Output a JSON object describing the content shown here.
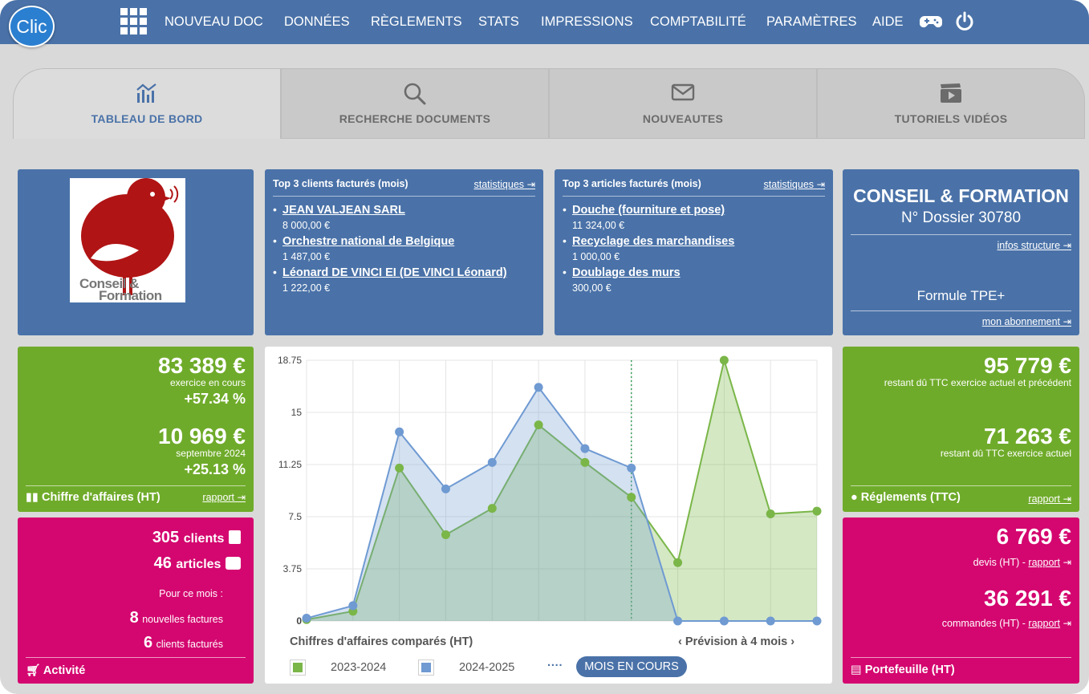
{
  "app": {
    "logo_text": "Clic"
  },
  "nav": {
    "items": [
      "NOUVEAU DOC",
      "DONNÉES",
      "RÈGLEMENTS",
      "STATS",
      "IMPRESSIONS",
      "COMPTABILITÉ",
      "PARAMÈTRES",
      "AIDE"
    ],
    "icons": [
      "apps-grid-icon",
      "gamepad-icon",
      "power-icon"
    ]
  },
  "tabs": [
    {
      "label": "TABLEAU DE BORD",
      "icon": "chart-icon",
      "active": true
    },
    {
      "label": "RECHERCHE DOCUMENTS",
      "icon": "search-icon",
      "active": false
    },
    {
      "label": "NOUVEAUTES",
      "icon": "envelope-icon",
      "active": false
    },
    {
      "label": "TUTORIELS VIDÉOS",
      "icon": "video-icon",
      "active": false
    }
  ],
  "company_logo": {
    "line1": "Conseil &",
    "line2": "Formation"
  },
  "top_clients": {
    "title": "Top 3 clients facturés (mois)",
    "link": "statistiques",
    "items": [
      {
        "name": "JEAN VALJEAN SARL",
        "value": "8 000,00 €"
      },
      {
        "name": "Orchestre national de Belgique",
        "value": "1 487,00 €"
      },
      {
        "name": "Léonard DE VINCI EI (DE VINCI Léonard)",
        "value": "1 222,00 €"
      }
    ]
  },
  "top_articles": {
    "title": "Top 3 articles facturés (mois)",
    "link": "statistiques",
    "items": [
      {
        "name": "Douche (fourniture et pose)",
        "value": "11 324,00 €"
      },
      {
        "name": "Recyclage des marchandises",
        "value": "1 000,00 €"
      },
      {
        "name": "Doublage des murs",
        "value": "300,00 €"
      }
    ]
  },
  "company": {
    "name": "CONSEIL & FORMATION",
    "dossier": "N° Dossier 30780",
    "infos_link": "infos structure",
    "formule": "Formule TPE+",
    "abonnement_link": "mon abonnement"
  },
  "ca": {
    "amount1": "83 389 €",
    "label1": "exercice en cours",
    "pct1": "+57.34 %",
    "amount2": "10 969 €",
    "label2": "septembre 2024",
    "pct2": "+25.13 %",
    "footer": "Chiffre d'affaires (HT)",
    "link": "rapport"
  },
  "activite": {
    "clients_count": "305",
    "clients_label": "clients",
    "articles_count": "46",
    "articles_label": "articles",
    "month_label": "Pour ce mois :",
    "factures_count": "8",
    "factures_label": "nouvelles factures",
    "factures_clients_count": "6",
    "factures_clients_label": "clients facturés",
    "footer": "Activité"
  },
  "reglements": {
    "amount1": "95 779 €",
    "label1": "restant dû TTC exercice actuel et précédent",
    "amount2": "71 263 €",
    "label2": "restant dû TTC exercice actuel",
    "footer": "Réglements (TTC)",
    "link": "rapport"
  },
  "portefeuille": {
    "devis_amount": "6 769 €",
    "devis_label": "devis (HT) -",
    "devis_link": "rapport",
    "commandes_amount": "36 291 €",
    "commandes_label": "commandes (HT) -",
    "commandes_link": "rapport",
    "footer": "Portefeuille (HT)"
  },
  "chart": {
    "caption": "Chiffres d'affaires comparés (HT)",
    "forecast_label": "Prévision à 4 mois",
    "legend_dots": "····",
    "current_month_button": "MOIS EN COURS"
  },
  "chart_data": {
    "type": "area",
    "ylim": [
      0,
      18.75
    ],
    "yticks": [
      "18.75",
      "15",
      "11.25",
      "7.5",
      "3.75",
      "0"
    ],
    "x": [
      1,
      2,
      3,
      4,
      5,
      6,
      7,
      8,
      9,
      10,
      11,
      12
    ],
    "current_month_index": 8,
    "series": [
      {
        "name": "2023-2024",
        "color": "#7ab648",
        "values": [
          0.1,
          0.7,
          11.0,
          6.2,
          8.1,
          14.1,
          11.4,
          8.9,
          4.2,
          18.75,
          7.7,
          7.9
        ]
      },
      {
        "name": "2024-2025",
        "color": "#6f9ad2",
        "values": [
          0.2,
          1.1,
          13.6,
          9.5,
          11.4,
          16.8,
          12.4,
          11.0,
          0.0,
          0.0,
          0.0,
          0.0
        ]
      }
    ],
    "grid": true
  }
}
